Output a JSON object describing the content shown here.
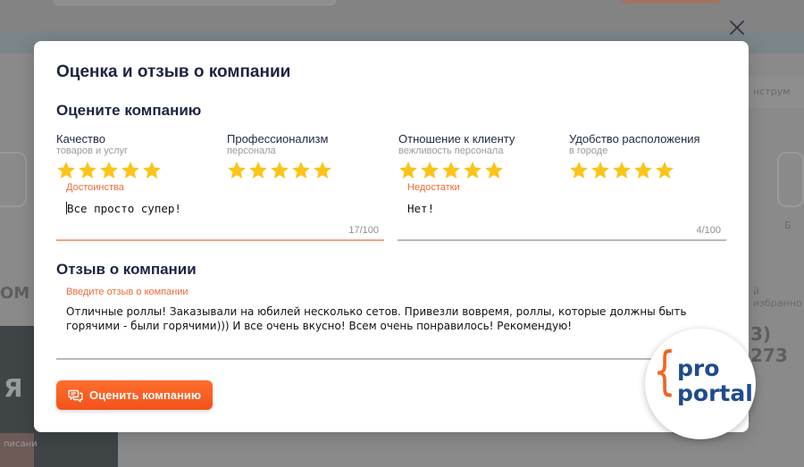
{
  "background": {
    "texts": [
      {
        "id": "bg-1",
        "text": "нструм"
      },
      {
        "id": "bg-2",
        "text": "3) 273"
      },
      {
        "id": "bg-3",
        "text": "Б"
      },
      {
        "id": "bg-4",
        "text": "ОМ"
      },
      {
        "id": "bg-5",
        "text": "й избранно"
      },
      {
        "id": "bg-6",
        "text": "писани"
      },
      {
        "id": "bg-7",
        "text": "Я"
      }
    ]
  },
  "modal": {
    "title": "Оценка и отзыв о компании",
    "rate_section_title": "Оцените компанию",
    "criteria": [
      {
        "label": "Качество",
        "sub": "товаров и услуг",
        "stars": 5,
        "max": 5
      },
      {
        "label": "Профессионализм",
        "sub": "персонала",
        "stars": 5,
        "max": 5
      },
      {
        "label": "Отношение к клиенту",
        "sub": "вежливость персонала",
        "stars": 5,
        "max": 5
      },
      {
        "label": "Удобство расположения",
        "sub": "в городе",
        "stars": 5,
        "max": 5
      }
    ],
    "pros": {
      "label": "Достоинства",
      "value": "Все просто супер!",
      "counter": "17/100"
    },
    "cons": {
      "label": "Недостатки",
      "value": "Нет!",
      "counter": "4/100"
    },
    "review_section_title": "Отзыв о компании",
    "review": {
      "label": "Введите отзыв о компании",
      "value": "Отличные роллы! Заказывали на юбилей несколько сетов. Привезли вовремя, роллы, которые должны быть горячими - были горячими))) И все очень вкусно! Всем очень понравилось! Рекомендую!"
    },
    "submit_label": "Оценить компанию"
  },
  "logo": {
    "line1": "pro",
    "line2": "portal",
    "brace": "{"
  },
  "colors": {
    "accent": "#f2531b",
    "star": "#fcc419",
    "title": "#1d2444",
    "field_label": "#ef6a3a",
    "logo_blue": "#1f4b8e",
    "logo_orange": "#f26522"
  },
  "icons": {
    "close": "close-icon",
    "star": "star-icon",
    "submit": "chat-bubbles-icon"
  }
}
